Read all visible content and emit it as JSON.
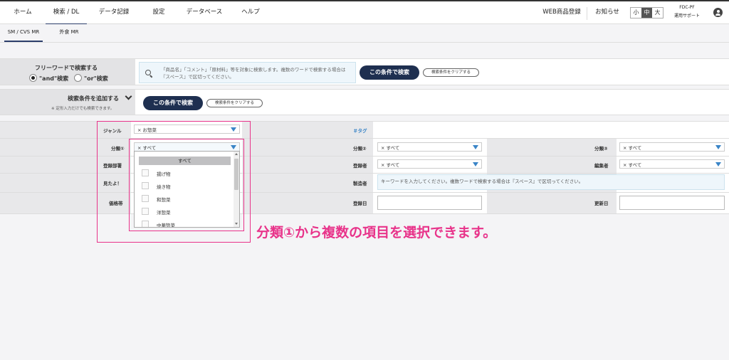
{
  "nav": {
    "items": [
      "ホーム",
      "検索 / DL",
      "データ記録",
      "設定",
      "データベース",
      "ヘルプ"
    ],
    "web_register": "WEB商品登録",
    "notice": "お知らせ",
    "size_options": [
      "小",
      "中",
      "大"
    ],
    "size_selected": "中",
    "company": "FDC-PF",
    "support": "運用サポート"
  },
  "subtabs": [
    "SM / CVS MR",
    "外食 MR"
  ],
  "freeword": {
    "title": "フリーワードで検索する",
    "and_label": "\"and\"検索",
    "or_label": "\"or\"検索",
    "selected": "and",
    "placeholder": "「商品名」「コメント」「原材料」等を対象に検索します。複数のワードで検索する場合は『スペース』で区切ってください。",
    "search_button": "この条件で検索",
    "clear_button": "検索条件をクリアする"
  },
  "add_condition": {
    "title": "検索条件を追加する",
    "note": "※ 定形入力だけでも検索できます。",
    "search_button": "この条件で検索",
    "clear_button": "検索条件をクリアする"
  },
  "form": {
    "genre_label": "ジャンル",
    "genre_value": "× お惣菜",
    "tag_label": "＃タグ",
    "bunrui1_label": "分類①",
    "bunrui1_value": "× すべて",
    "bunrui2_label": "分類②",
    "bunrui2_value": "× すべて",
    "bunrui3_label": "分類③",
    "bunrui3_value": "× すべて",
    "dept_label": "登録部署",
    "registrant_label": "登録者",
    "registrant_value": "× すべて",
    "editor_label": "編集者",
    "editor_value": "× すべて",
    "mitayo_label": "見たよ！",
    "maker_label": "製造者",
    "maker_placeholder": "キーワードを入力してください。複数ワードで検索する場合は『スペース』で区切ってください。",
    "price_label": "価格帯",
    "reg_date_label": "登録日",
    "update_date_label": "更新日"
  },
  "dropdown": {
    "all_label": "すべて",
    "options": [
      "揚げ物",
      "焼き物",
      "和惣菜",
      "洋惣菜",
      "中華惣菜"
    ]
  },
  "annotation": "分類①から複数の項目を選択できます。",
  "colors": {
    "navy": "#1e2f50",
    "annotation_pink": "#e8338a",
    "select_arrow": "#3a85c7",
    "tag_blue": "#3a85c7"
  }
}
